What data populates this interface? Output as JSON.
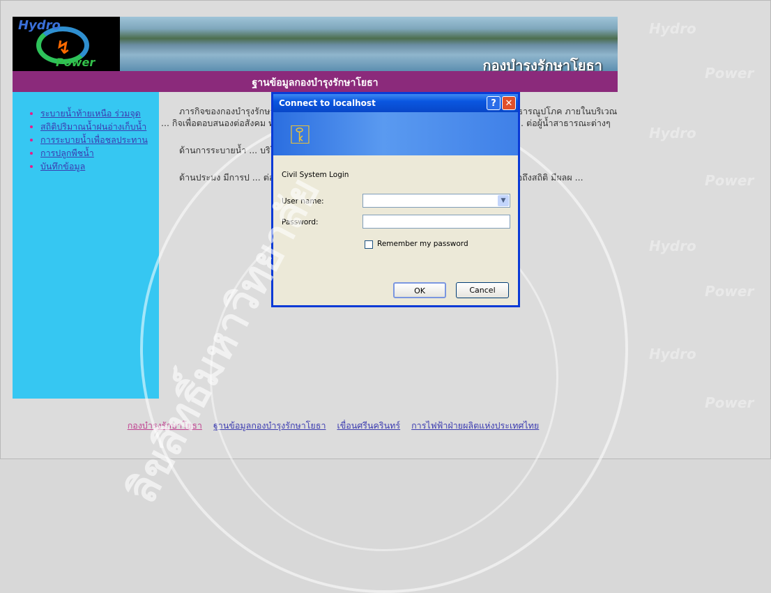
{
  "site": {
    "logo_top": "Hydro",
    "logo_bottom": "Power",
    "title": "กองบำรุงรักษาโยธา",
    "subtitle": "ฐานข้อมูลกองบำรุงรักษาโยธา"
  },
  "sidebar": {
    "items": [
      {
        "label": "ระบายน้ำท้ายเหนือ ร่วมจุด"
      },
      {
        "label": "สถิติปริมาณน้ำฝนอ่างเก็บน้ำ"
      },
      {
        "label": "การระบายน้ำเพื่อชลประทาน"
      },
      {
        "label": "การปลูกพืชน้ำ"
      },
      {
        "label": "บันทึกข้อมูล"
      }
    ]
  },
  "content": {
    "paragraphs": [
      "ภารกิจของกองบำรุงรักษาโยธา ... ความมั่นคงของตัวเขื่อน อาคารประกอบ ... และระบบสาธารณูปโภค ภายในบริเวณ ... กิจเพื่อตอบสนองต่อสังคม ทั้งด้านการระ ... ในพื้นที่ท้ายเขื่อนการทำปลา และด้านการประมง ... ต่อผู้น้ำสาธารณะต่างๆ",
      "ด้านการระบายน้ำ ... บริโภค เฉลี่ยประมาณ 5 ล้านลูกบาศก์ ...",
      "ด้านประมง มีการป ... ต่อปี ทั้งนี้การสำรวจเก็บข้อมูลการจับ ... า 600 ตัน ทั้งนี้หลังได้รับหรือถึงสถิติ มีผลผ ..."
    ]
  },
  "footer": {
    "links": [
      {
        "label": "กองบำรุงรักษาโยธา"
      },
      {
        "label": "ฐานข้อมูลกองบำรุงรักษาโยธา"
      },
      {
        "label": "เขื่อนศรีนครินทร์"
      },
      {
        "label": "การไฟฟ้าฝ่ายผลิตแห่งประเทศไทย"
      }
    ]
  },
  "dialog": {
    "title": "Connect to localhost",
    "help_label": "?",
    "close_label": "✕",
    "realm": "Civil System Login",
    "username_label": "User name:",
    "username_value": "",
    "password_label": "Password:",
    "password_value": "",
    "remember_label": "Remember my password",
    "ok_label": "OK",
    "cancel_label": "Cancel"
  },
  "watermark": {
    "text": "Hydro",
    "text2": "Power"
  },
  "seal": {
    "arc_text": "ลิขสิทธิ์มหาวิทยาลัย"
  }
}
